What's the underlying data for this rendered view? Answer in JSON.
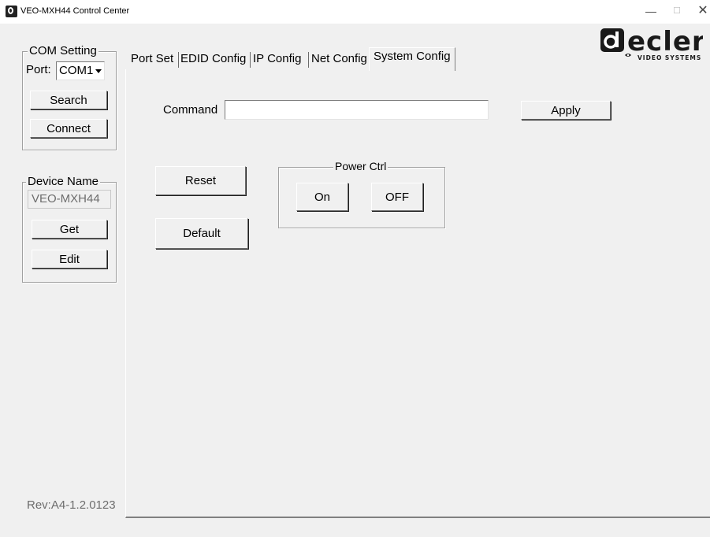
{
  "window": {
    "title": "VEO-MXH44 Control Center",
    "controls": {
      "minimize": "—",
      "maximize": "☐",
      "close": "✕"
    }
  },
  "com_setting": {
    "legend": "COM Setting",
    "port_label": "Port:",
    "port_value": "COM1",
    "search_label": "Search",
    "connect_label": "Connect"
  },
  "device_name": {
    "legend": "Device Name",
    "value": "VEO-MXH44",
    "get_label": "Get",
    "edit_label": "Edit"
  },
  "revision": "Rev:A4-1.2.0123",
  "tabs": [
    {
      "label": "Port Set"
    },
    {
      "label": "EDID Config"
    },
    {
      "label": "IP Config"
    },
    {
      "label": "Net Config"
    },
    {
      "label": "System Config",
      "active": true
    }
  ],
  "system_config": {
    "command_label": "Command",
    "command_value": "",
    "apply_label": "Apply",
    "reset_label": "Reset",
    "default_label": "Default",
    "power_ctrl": {
      "legend": "Power Ctrl",
      "on_label": "On",
      "off_label": "OFF"
    }
  },
  "logo": {
    "brand": "ecler",
    "tagline": "VIDEO SYSTEMS",
    "color": "#1a1a1a"
  }
}
